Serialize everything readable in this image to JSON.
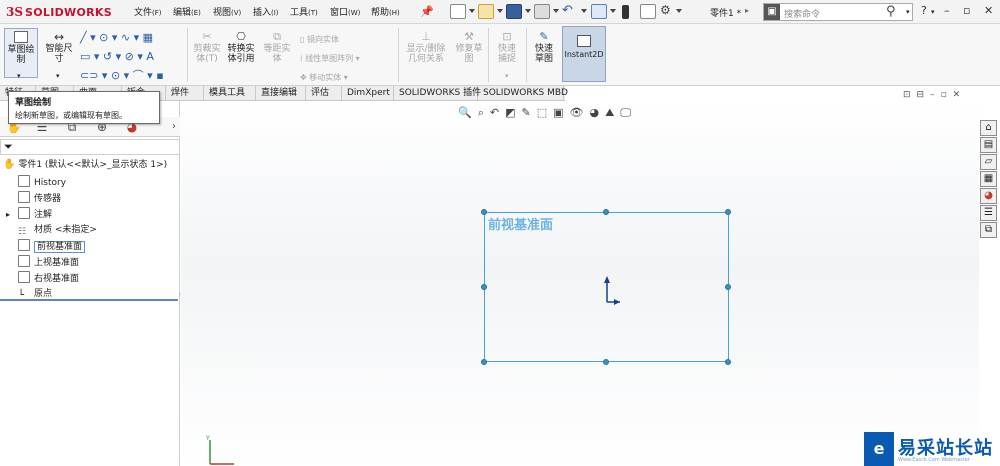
{
  "app": {
    "brand_ds": "3S",
    "brand_name": "SOLIDWORKS"
  },
  "menu": [
    {
      "label": "文件",
      "key": "(F)"
    },
    {
      "label": "编辑",
      "key": "(E)"
    },
    {
      "label": "视图",
      "key": "(V)"
    },
    {
      "label": "插入",
      "key": "(I)"
    },
    {
      "label": "工具",
      "key": "(T)"
    },
    {
      "label": "窗口",
      "key": "(W)"
    },
    {
      "label": "帮助",
      "key": "(H)"
    }
  ],
  "document": {
    "title": "零件1 *"
  },
  "search": {
    "placeholder": "搜索命令"
  },
  "window_controls": {
    "help": "?",
    "minimize": "–",
    "restore": "▫",
    "close": "✕"
  },
  "ribbon": {
    "sketch": "草图绘制",
    "smart_dimension": "智能尺寸",
    "trim_entities": "剪裁实体(T)",
    "convert_entities": "转换实体引用",
    "offset_entities": "等距实体",
    "mirror_entities": "镜向实体",
    "linear_pattern": "线性草图阵列",
    "move_entities": "移动实体",
    "display_delete_relations": "显示/删除几何关系",
    "repair_sketch": "修复草图",
    "quick_snaps": "快速捕捉",
    "rapid_sketch": "快速草图",
    "instant2d": "Instant2D"
  },
  "tabs": [
    "特征",
    "草图",
    "曲面",
    "钣金",
    "焊件",
    "模具工具",
    "直接编辑",
    "评估",
    "DimXpert",
    "SOLIDWORKS 插件",
    "SOLIDWORKS MBD"
  ],
  "tooltip": {
    "title": "草图绘制",
    "body": "绘制新草图，或编辑现有草图。"
  },
  "tree": {
    "root": "零件1 (默认<<默认>_显示状态 1>)",
    "items": [
      {
        "label": "History",
        "icon": "history-icon"
      },
      {
        "label": "传感器",
        "icon": "sensor-icon"
      },
      {
        "label": "注解",
        "icon": "annotation-icon",
        "expand": "▸"
      },
      {
        "label": "材质 <未指定>",
        "icon": "material-icon"
      },
      {
        "label": "前视基准面",
        "icon": "plane-icon",
        "selected": true
      },
      {
        "label": "上视基准面",
        "icon": "plane-icon"
      },
      {
        "label": "右视基准面",
        "icon": "plane-icon"
      },
      {
        "label": "原点",
        "icon": "origin-icon"
      }
    ]
  },
  "viewport": {
    "plane_label": "前视基准面"
  },
  "watermark": {
    "logo": "e",
    "text": "易采站长站",
    "sub": "Www.Easck.Com Webmaster"
  },
  "colors": {
    "brand": "#c8102e",
    "plane": "#4a9fd8",
    "watermark": "#0b5ab1"
  }
}
